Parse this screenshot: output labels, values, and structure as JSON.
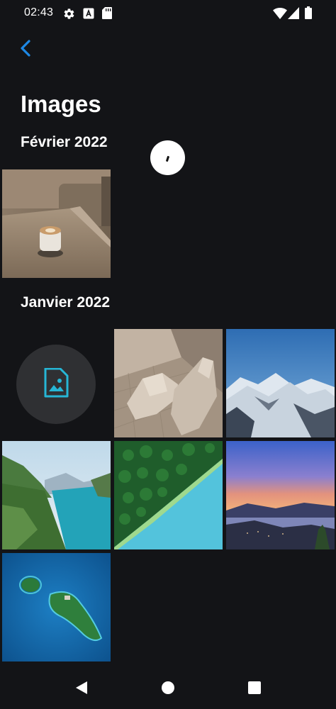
{
  "status_bar": {
    "time": "02:43",
    "left_icons": [
      "settings-icon",
      "font-icon",
      "sd-card-icon"
    ],
    "right_icons": [
      "wifi-icon",
      "signal-icon",
      "battery-icon"
    ]
  },
  "header": {
    "back_icon": "chevron-left-icon",
    "title": "Images"
  },
  "sections": [
    {
      "title": "Février 2022",
      "photos": [
        "coffee-cup-photo"
      ]
    },
    {
      "title": "Janvier 2022",
      "photos": [
        "image-placeholder",
        "wooden-dog-sculpture-photo",
        "snowy-mountains-photo",
        "lake-valley-photo",
        "forest-lake-aerial-photo",
        "sunset-lake-photo",
        "island-aerial-photo"
      ]
    }
  ],
  "nav_bar": {
    "back": "triangle-back-icon",
    "home": "circle-home-icon",
    "recents": "square-recents-icon"
  },
  "colors": {
    "background": "#131417",
    "accent": "#1e88e5",
    "placeholder_icon": "#26b6d6"
  }
}
